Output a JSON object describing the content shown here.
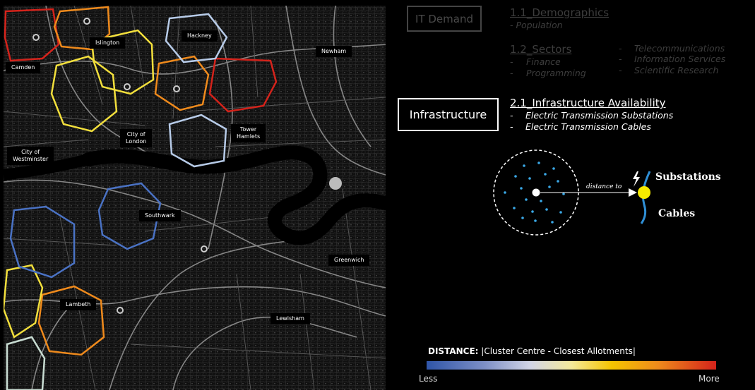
{
  "map": {
    "labels": [
      {
        "id": "camden",
        "text": "Camden"
      },
      {
        "id": "islington",
        "text": "Islington"
      },
      {
        "id": "hackney",
        "text": "Hackney"
      },
      {
        "id": "newham",
        "text": "Newham"
      },
      {
        "id": "city-of-london",
        "text": "City of\nLondon"
      },
      {
        "id": "tower-hamlets",
        "text": "Tower\nHamlets"
      },
      {
        "id": "city-of-westminster",
        "text": "City of\nWestminster"
      },
      {
        "id": "southwark",
        "text": "Southwark"
      },
      {
        "id": "greenwich",
        "text": "Greenwich"
      },
      {
        "id": "lambeth",
        "text": "Lambeth"
      },
      {
        "id": "lewisham",
        "text": "Lewisham"
      }
    ],
    "cluster_colors": {
      "far": "#d4231b",
      "high": "#ef8a1c",
      "mid": "#f2df3c",
      "low": "#b7cbe8",
      "near": "#4a72c4",
      "pale": "#c8dcd2"
    }
  },
  "panel": {
    "it_demand": "IT Demand",
    "demographics": {
      "title": "1.1_Demographics",
      "items": [
        "- Population"
      ]
    },
    "sectors": {
      "title": "1.2_Sectors",
      "left": [
        "Finance",
        "Programming"
      ],
      "right": [
        "Telecommunications",
        "Information Services",
        "Scientific Research"
      ]
    },
    "infrastructure": "Infrastructure",
    "infra_availability": {
      "title": "2.1_Infrastructure Availability",
      "items": [
        "Electric Transmission Substations",
        "Electric Transmission Cables"
      ]
    },
    "diagram": {
      "distance_to": "distance to",
      "substations": "Substations",
      "cables": "Cables"
    },
    "legend": {
      "title_bold": "DISTANCE:",
      "title_rest": " |Cluster Centre - Closest Allotments|",
      "less": "Less",
      "more": "More"
    }
  }
}
